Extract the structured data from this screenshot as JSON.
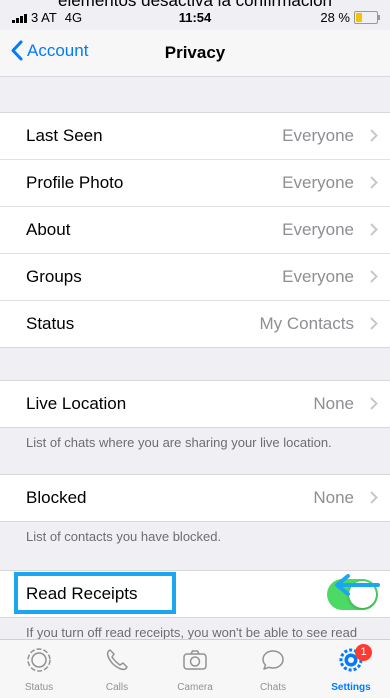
{
  "top_cut_text": "elementos desactiva la confirmación",
  "status_bar": {
    "carrier": "3 AT",
    "network": "4G",
    "time": "11:54",
    "battery": "28 %",
    "battery_level": 0.28
  },
  "nav": {
    "back_label": "Account",
    "title": "Privacy"
  },
  "privacy_rows": [
    {
      "label": "Last Seen",
      "value": "Everyone"
    },
    {
      "label": "Profile Photo",
      "value": "Everyone"
    },
    {
      "label": "About",
      "value": "Everyone"
    },
    {
      "label": "Groups",
      "value": "Everyone"
    },
    {
      "label": "Status",
      "value": "My Contacts"
    }
  ],
  "live_location": {
    "label": "Live Location",
    "value": "None",
    "note": "List of chats where you are sharing your live location."
  },
  "blocked": {
    "label": "Blocked",
    "value": "None",
    "note": "List of contacts you have blocked."
  },
  "read_receipts": {
    "label": "Read Receipts",
    "enabled": true,
    "note": "If you turn off read receipts, you won't be able to see read receipts from other people. Read receipts are"
  },
  "tabs": [
    {
      "label": "Status",
      "icon": "status-icon"
    },
    {
      "label": "Calls",
      "icon": "phone-icon"
    },
    {
      "label": "Camera",
      "icon": "camera-icon"
    },
    {
      "label": "Chats",
      "icon": "chat-bubble-icon"
    },
    {
      "label": "Settings",
      "icon": "gear-icon",
      "badge": "1",
      "active": true
    }
  ],
  "colors": {
    "accent": "#007aff",
    "toggle_on": "#4cd964",
    "highlight": "#1aa7f0",
    "badge": "#ff3b30",
    "battery": "#f5c400"
  }
}
